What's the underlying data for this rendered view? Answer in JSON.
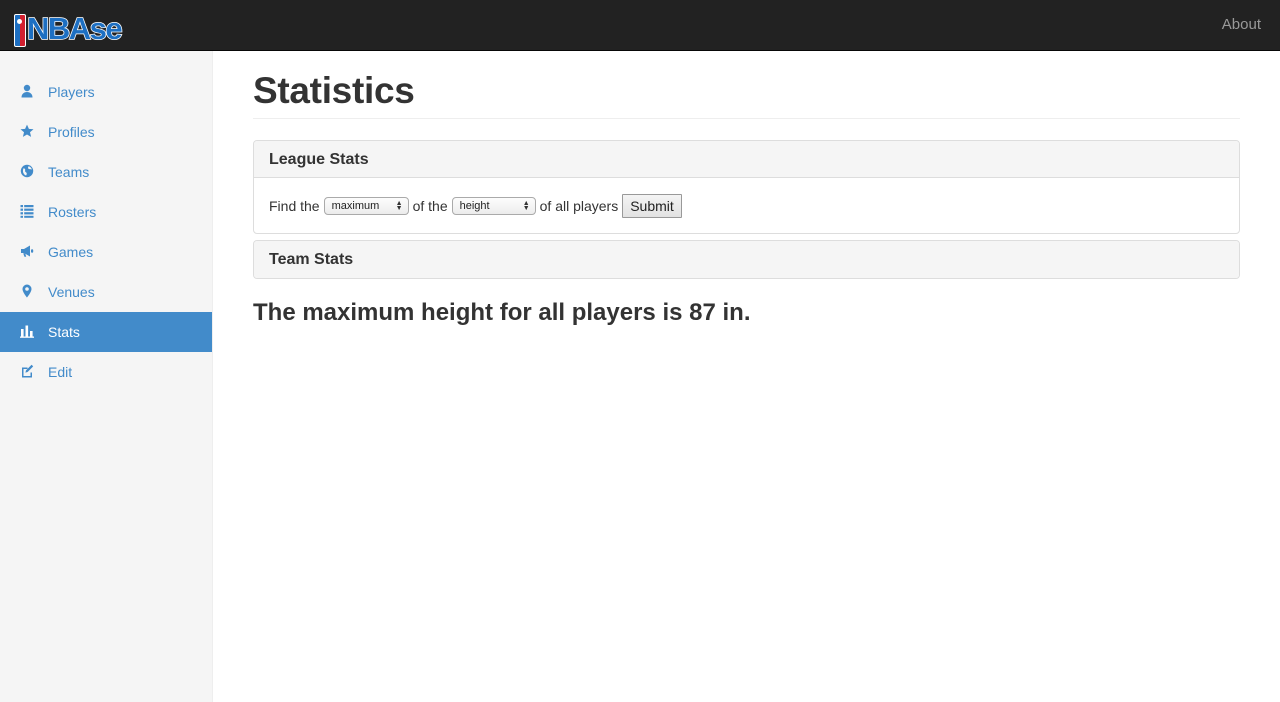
{
  "app": {
    "logo_text": "NBAse",
    "about_label": "About"
  },
  "sidebar": {
    "items": [
      {
        "label": "Players",
        "icon": "user-icon",
        "active": false
      },
      {
        "label": "Profiles",
        "icon": "star-icon",
        "active": false
      },
      {
        "label": "Teams",
        "icon": "globe-icon",
        "active": false
      },
      {
        "label": "Rosters",
        "icon": "list-icon",
        "active": false
      },
      {
        "label": "Games",
        "icon": "bullhorn-icon",
        "active": false
      },
      {
        "label": "Venues",
        "icon": "map-marker-icon",
        "active": false
      },
      {
        "label": "Stats",
        "icon": "stats-icon",
        "active": true
      },
      {
        "label": "Edit",
        "icon": "edit-icon",
        "active": false
      }
    ]
  },
  "main": {
    "title": "Statistics",
    "league_panel": {
      "heading": "League Stats",
      "text_find": "Find the",
      "aggregate_value": "maximum",
      "text_of_the": "of the",
      "field_value": "height",
      "text_of_all": "of all players",
      "submit_label": "Submit"
    },
    "team_panel": {
      "heading": "Team Stats"
    },
    "result_text": "The maximum height for all players is 87 in."
  },
  "colors": {
    "navbar": "#222222",
    "accent": "#428bca",
    "sidebar_bg": "#f5f5f5"
  }
}
